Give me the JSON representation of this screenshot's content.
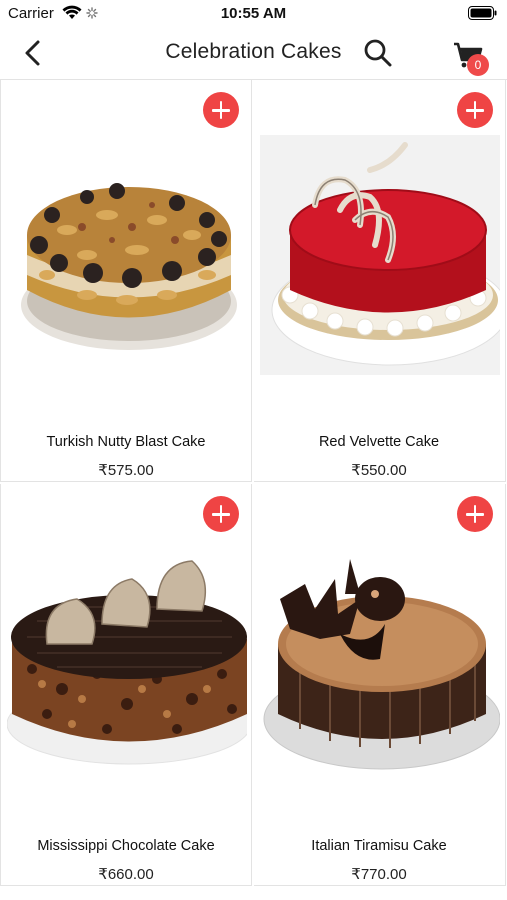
{
  "status_bar": {
    "carrier": "Carrier",
    "time": "10:55 AM"
  },
  "nav": {
    "title": "Celebration Cakes",
    "cart_count": "0",
    "back_icon": "chevron-left-icon",
    "search_icon": "search-icon",
    "cart_icon": "shopping-cart-icon"
  },
  "colors": {
    "accent": "#ef4444",
    "divider": "#e3e3e3"
  },
  "products": [
    {
      "name": "Turkish Nutty Blast Cake",
      "price": "₹575.00"
    },
    {
      "name": "Red Velvette Cake",
      "price": "₹550.00"
    },
    {
      "name": "Mississippi Chocolate Cake",
      "price": "₹660.00"
    },
    {
      "name": "Italian Tiramisu Cake",
      "price": "₹770.00"
    }
  ]
}
